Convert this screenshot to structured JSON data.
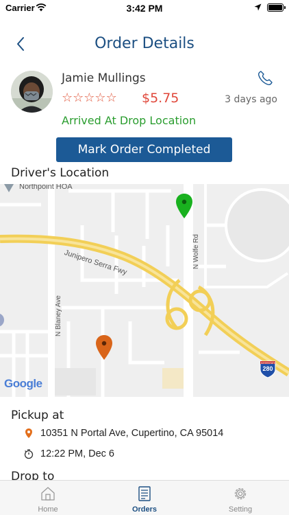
{
  "status_bar": {
    "carrier": "Carrier",
    "time": "3:42 PM"
  },
  "header": {
    "title": "Order Details"
  },
  "customer": {
    "name": "Jamie Mullings",
    "rating": 0,
    "rating_max": 5,
    "price": "$5.75",
    "time_ago": "3 days ago",
    "status": "Arrived At Drop Location"
  },
  "action": {
    "complete_label": "Mark Order Completed"
  },
  "driver_location": {
    "label": "Driver's Location",
    "map_labels": {
      "place": "Northpoint HOA",
      "freeway": "Junipero Serra Fwy",
      "road_wolfe": "N Wolfe Rd",
      "road_blaney": "N Blaney Ave",
      "shield_number": "280",
      "shield_text": "INTERSTATE",
      "attribution": "Google"
    }
  },
  "pickup": {
    "label": "Pickup at",
    "address": "10351 N Portal Ave, Cupertino, CA 95014",
    "time": "12:22 PM, Dec 6"
  },
  "drop": {
    "label": "Drop to"
  },
  "tabs": [
    {
      "label": "Home",
      "icon": "home-icon",
      "active": false
    },
    {
      "label": "Orders",
      "icon": "orders-icon",
      "active": true
    },
    {
      "label": "Setting",
      "icon": "gear-icon",
      "active": false
    }
  ],
  "colors": {
    "brand": "#1c4f82",
    "button": "#1c5a96",
    "status_green": "#2a9d2f",
    "price_red": "#e0473a",
    "pin_green": "#19b11f",
    "pin_orange": "#d9651a"
  }
}
